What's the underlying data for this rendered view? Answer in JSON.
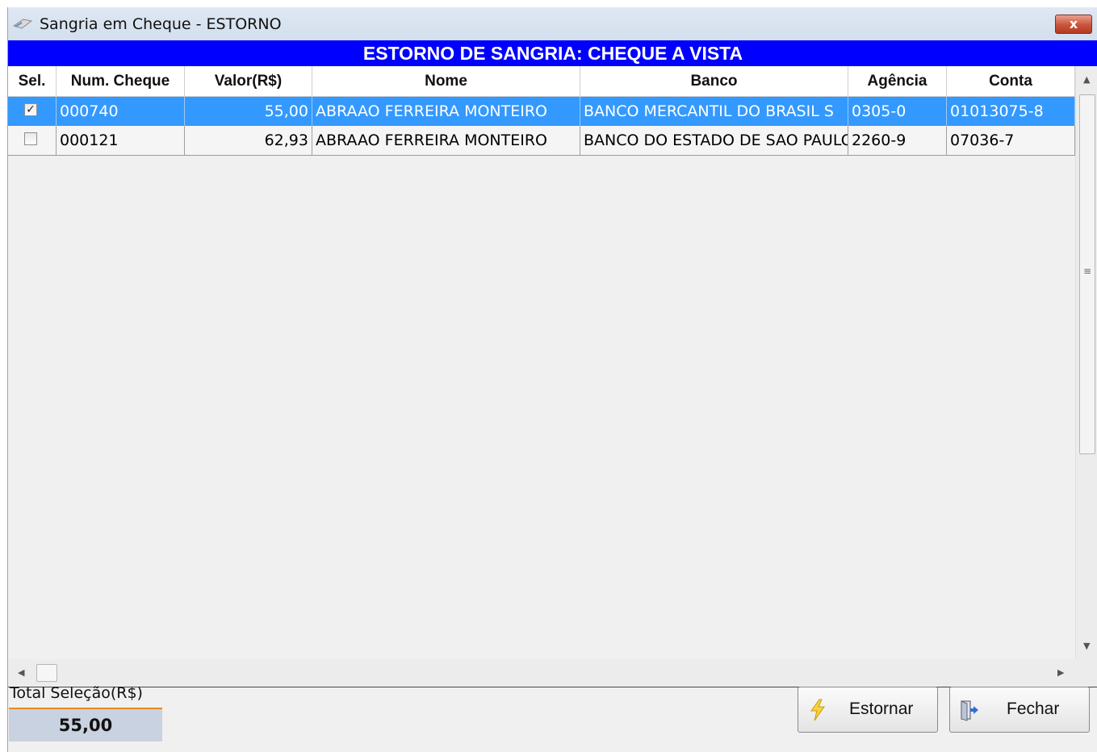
{
  "window": {
    "title": "Sangria em Cheque - ESTORNO",
    "close_label": "x"
  },
  "banner": "ESTORNO DE SANGRIA: CHEQUE A VISTA",
  "grid": {
    "columns": [
      "Sel.",
      "Num. Cheque",
      "Valor(R$)",
      "Nome",
      "Banco",
      "Agência",
      "Conta"
    ],
    "rows": [
      {
        "selected": true,
        "num": "000740",
        "valor": "55,00",
        "nome": "ABRAAO FERREIRA MONTEIRO",
        "banco": "BANCO MERCANTIL DO BRASIL S",
        "agencia": "0305-0",
        "conta": "01013075-8"
      },
      {
        "selected": false,
        "num": "000121",
        "valor": "62,93",
        "nome": "ABRAAO FERREIRA MONTEIRO",
        "banco": "BANCO DO ESTADO DE SAO PAULO",
        "agencia": "2260-9",
        "conta": "07036-7"
      }
    ]
  },
  "total": {
    "label": "Total Seleção(R$)",
    "value": "55,00"
  },
  "buttons": {
    "estornar": "Estornar",
    "fechar": "Fechar"
  },
  "colors": {
    "banner": "#0000ff",
    "selected_row": "#3399ff",
    "total_accent": "#e58a1f"
  }
}
